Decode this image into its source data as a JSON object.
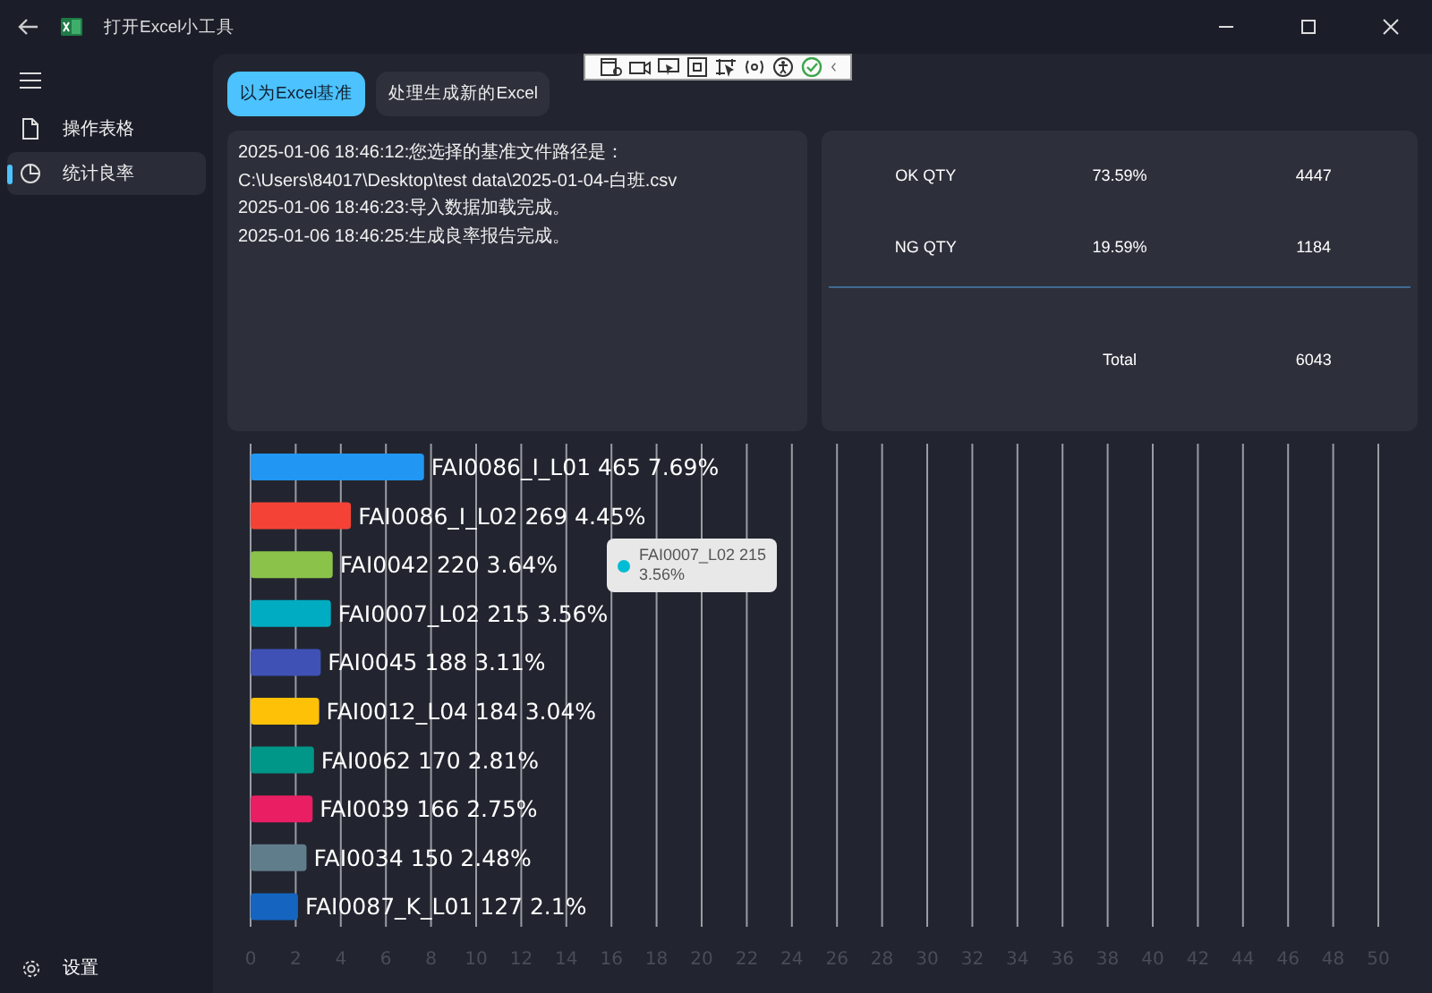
{
  "window": {
    "title": "打开Excel小工具"
  },
  "sidebar": {
    "items": [
      {
        "label": "操作表格",
        "selected": false
      },
      {
        "label": "统计良率",
        "selected": true
      }
    ],
    "footer": {
      "label": "设置"
    }
  },
  "tabs": [
    {
      "label": "以为Excel基准",
      "selected": true
    },
    {
      "label": "处理生成新的Excel",
      "selected": false
    }
  ],
  "log": {
    "lines": [
      "2025-01-06 18:46:12:您选择的基准文件路径是：C:\\Users\\84017\\Desktop\\test data\\2025-01-04-白班.csv",
      "2025-01-06 18:46:23:导入数据加载完成。",
      "2025-01-06 18:46:25:生成良率报告完成。"
    ]
  },
  "stats": {
    "rows": [
      {
        "label": "OK QTY",
        "percent": "73.59%",
        "count": "4447"
      },
      {
        "label": "NG QTY",
        "percent": "19.59%",
        "count": "1184"
      }
    ],
    "total": {
      "label": "Total",
      "count": "6043"
    }
  },
  "chart": {
    "chart_data": {
      "type": "bar",
      "orientation": "horizontal",
      "grid": true,
      "categories": [
        "FAI0086_I_L01",
        "FAI0086_I_L02",
        "FAI0042",
        "FAI0007_L02",
        "FAI0045",
        "FAI0012_L04",
        "FAI0062",
        "FAI0039",
        "FAI0034",
        "FAI0087_K_L01"
      ],
      "series": [
        {
          "values": [
            7.69,
            4.45,
            3.64,
            3.56,
            3.11,
            3.04,
            2.81,
            2.75,
            2.48,
            2.1
          ]
        }
      ],
      "value_labels": [
        "465 7.69%",
        "269 4.45%",
        "220 3.64%",
        "215 3.56%",
        "188 3.11%",
        "184 3.04%",
        "170 2.81%",
        "166 2.75%",
        "150 2.48%",
        "127 2.1%"
      ],
      "xlim": [
        0,
        50
      ],
      "xticks": [
        0,
        2,
        4,
        6,
        8,
        10,
        12,
        14,
        16,
        18,
        20,
        22,
        24,
        26,
        28,
        30,
        32,
        34,
        36,
        38,
        40,
        42,
        44,
        46,
        48,
        50
      ]
    },
    "bars": [
      {
        "color": "#2196f3"
      },
      {
        "color": "#f44336"
      },
      {
        "color": "#8bc34a"
      },
      {
        "color": "#00acc1"
      },
      {
        "color": "#3f51b5"
      },
      {
        "color": "#ffc107"
      },
      {
        "color": "#009688"
      },
      {
        "color": "#e91e63"
      },
      {
        "color": "#607d8b"
      },
      {
        "color": "#1565c0"
      }
    ],
    "tooltip": {
      "lines": [
        "FAI0007_L02 215",
        "3.56%"
      ],
      "color": "#00bcd4"
    }
  }
}
